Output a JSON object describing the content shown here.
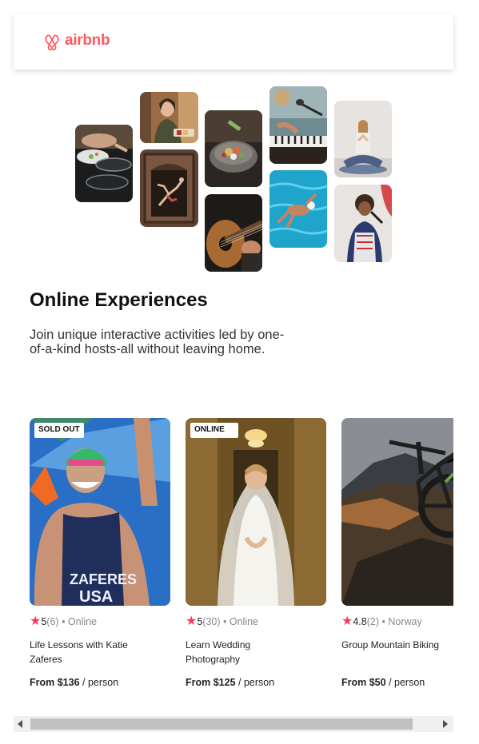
{
  "brand": {
    "name": "airbnb",
    "color": "#ff5a5f",
    "logo_icon": "airbnb-belo-icon"
  },
  "hero": {
    "title": "Online Experiences",
    "subtitle": "Join unique interactive activities led by one-of-a-kind hosts-all without leaving home."
  },
  "collage": [
    {
      "subject": "cooking-pans"
    },
    {
      "subject": "woman-smiling"
    },
    {
      "subject": "dancer-in-doorway"
    },
    {
      "subject": "food-bowl"
    },
    {
      "subject": "guitar"
    },
    {
      "subject": "piano-mic"
    },
    {
      "subject": "swimmer"
    },
    {
      "subject": "yoga"
    },
    {
      "subject": "singer"
    }
  ],
  "cards": [
    {
      "badge": "SOLD OUT",
      "score": "5",
      "reviews": "(6)",
      "location": "• Online",
      "title": "Life Lessons with Katie Zaferes",
      "price": "From $136",
      "unit": " / person"
    },
    {
      "badge": "ONLINE",
      "score": "5",
      "reviews": "(30)",
      "location": "• Online",
      "title": "Learn Wedding Photography",
      "price": "From $125",
      "unit": " / person"
    },
    {
      "badge": "",
      "score": "4.8",
      "reviews": "(2)",
      "location": "• Norway",
      "title": "Group Mountain Biking",
      "price": "From $50",
      "unit": " / person"
    }
  ],
  "accent": "#ff385c"
}
